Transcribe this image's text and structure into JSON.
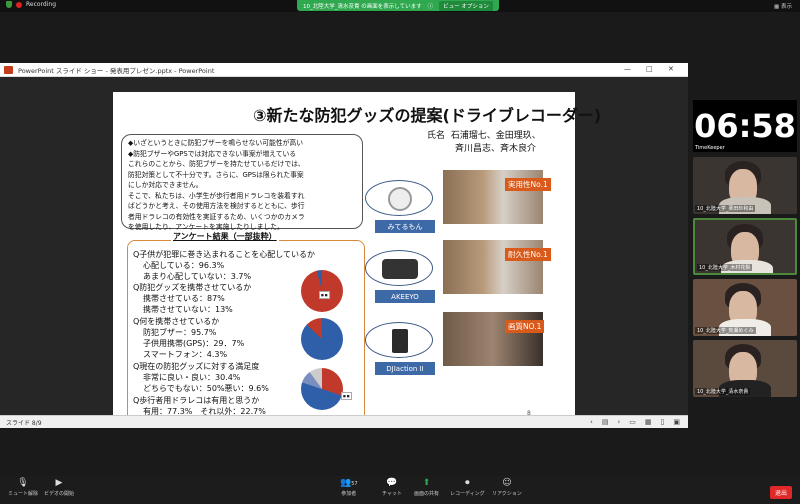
{
  "zoom_top": {
    "recording": "Recording",
    "share_banner": "10_北陸大学_清水奈貴 の画面を表示しています",
    "view_options": "ビュー オプション",
    "display": "表示"
  },
  "ppt": {
    "window_title": "PowerPoint スライド ショー - 発表用プレゼン.pptx - PowerPoint",
    "status": "スライド 8/9",
    "minimize": "—",
    "maximize": "□",
    "close": "✕"
  },
  "slide": {
    "title": "③新たな防犯グッズの提案(ドライブレコーダー)",
    "names_label": "氏名",
    "names_line1": "石浦瑠七、金田理玖、",
    "names_line2": "斉川昌志、斉木良介",
    "intro_lines": [
      "◆いざというときに防犯ブザーを鳴らせない可能性が高い",
      "◆防犯ブザーやGPSでは対応できない事案が増えている",
      "これらのことから、防犯ブザーを持たせているだけでは、",
      "防犯対策として不十分です。さらに、GPSは限られた事案",
      "にしか対応できません。",
      "そこで、私たちは、小学生が歩行者用ドラレコを装着すれ",
      "ばどうかと考え、その使用方法を検討するとともに、歩行",
      "者用ドラレコの有効性を実証するため、いくつかのカメラ",
      "を使用したり、アンケートを実施したりしました。"
    ],
    "survey_heading": "アンケート結果（一部抜粋）",
    "survey_lines": [
      "Q子供が犯罪に巻き込まれることを心配しているか",
      "心配している：96.3%",
      "あまり心配していない：3.7%",
      "Q防犯グッズを携帯させているか",
      "携帯させている：87%",
      "携帯させていない：13%",
      "Q何を携帯させているか",
      "防犯ブザー：95.7%",
      "子供用携帯(GPS)：29．7%",
      "スマートフォン：4.3%",
      "Q現在の防犯グッズに対する満足度",
      "非常に良い・良い：30.4%",
      "どちらでもない：50%悪い：9.6%",
      "Q歩行者用ドラレコは有用と思うか",
      "有用：77.3%　それ以外：22.7%"
    ],
    "products": [
      {
        "label": "みてるもん",
        "rank": "実用性No.1"
      },
      {
        "label": "AKEEYO",
        "rank": "耐久性No.1"
      },
      {
        "label": "DJIaction II",
        "rank": "画質NO.1"
      }
    ],
    "page_number": "8"
  },
  "participants": {
    "timer": "06:58",
    "timekeeper": "TimeKeeper",
    "tiles": [
      "10_北陸大学_栗田紗和由",
      "10_北陸大学_木村花梨",
      "10_北陸大学_荒瀬めぐみ",
      "10_北陸大学_清水奈貴"
    ]
  },
  "bottom": {
    "mute": "ミュート解除",
    "video": "ビデオの開始",
    "participants": "参加者",
    "participants_count": "57",
    "chat": "チャット",
    "share": "画面の共有",
    "record": "レコーディング",
    "reactions": "リアクション",
    "leave": "退出"
  },
  "colors": {
    "share_green": "#2fa84f",
    "leave_red": "#e02828",
    "ppt_orange": "#c43e1c",
    "label_blue": "#3d6aa6",
    "rank_orange": "#d95a1a"
  }
}
